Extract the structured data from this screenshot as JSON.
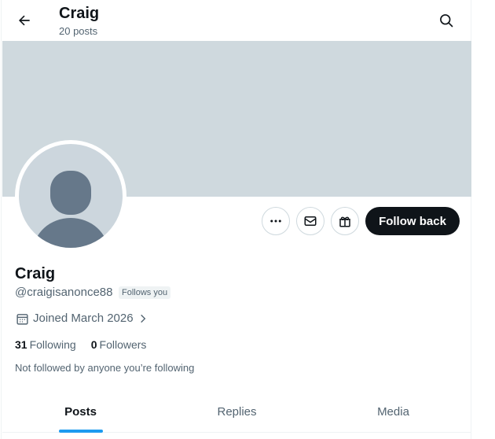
{
  "header": {
    "name": "Craig",
    "post_count": "20 posts",
    "back_icon": "arrow-left-icon",
    "search_icon": "search-icon"
  },
  "profile": {
    "display_name": "Craig",
    "handle": "@craigisanonce88",
    "follows_you_badge": "Follows you",
    "joined": "Joined March 2026",
    "following_count": "31",
    "following_label": "Following",
    "followers_count": "0",
    "followers_label": "Followers",
    "mutuals_note": "Not followed by anyone you’re following"
  },
  "actions": {
    "more_icon": "more-horizontal-icon",
    "message_icon": "envelope-icon",
    "gift_icon": "gift-icon",
    "follow_label": "Follow back"
  },
  "tabs": [
    {
      "label": "Posts",
      "active": true
    },
    {
      "label": "Replies",
      "active": false
    },
    {
      "label": "Media",
      "active": false
    }
  ],
  "colors": {
    "banner": "#cfd9de",
    "accent": "#1d9bf0",
    "follow_button": "#0f1419",
    "avatar_bg": "#ccd6dd",
    "avatar_figure": "#66788a"
  }
}
